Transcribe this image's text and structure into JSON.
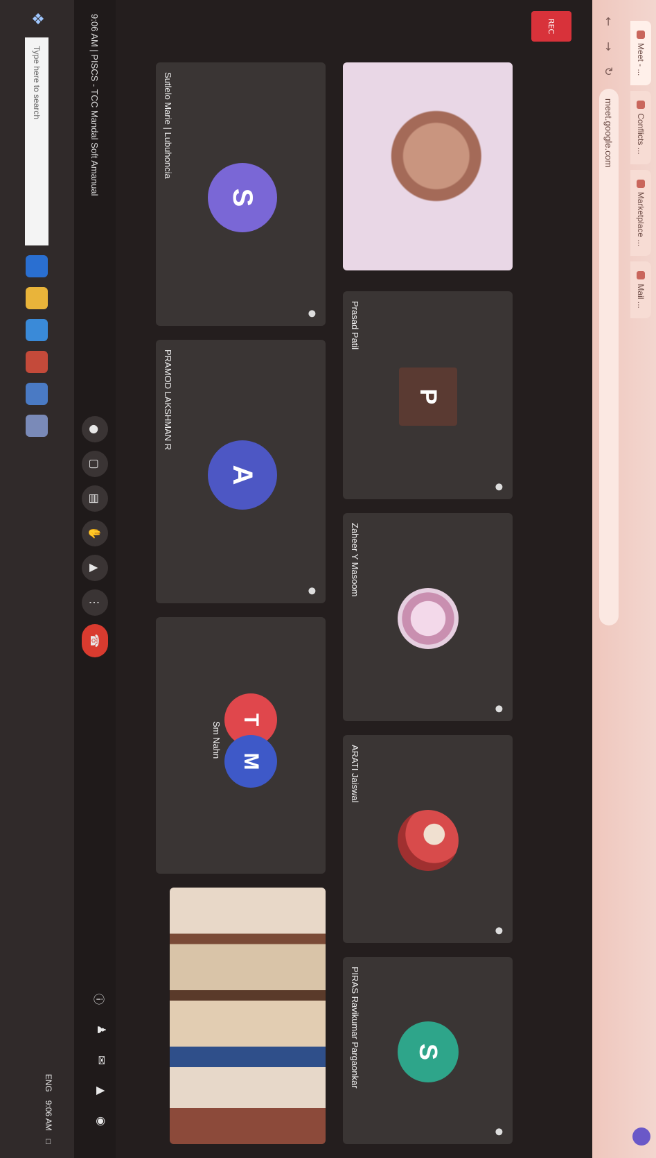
{
  "browser": {
    "tabs": [
      {
        "label": "Meet - ..."
      },
      {
        "label": "Conflicts ..."
      },
      {
        "label": "Marketplace ..."
      },
      {
        "label": "Mail ..."
      }
    ],
    "url": "meet.google.com"
  },
  "meeting": {
    "recording_label": "REC",
    "tiles": [
      {
        "name": "Sutlelo Marie | Lubuhoncia",
        "initial": "S",
        "color": "#7a67d6"
      },
      {
        "name": "PRAMOD LAKSHMAN R",
        "initial": "A",
        "color": "#4d57c4"
      },
      {
        "name": "Sm Nahn",
        "initial": "T",
        "color": "#e0474c",
        "initial2": "M",
        "color2": "#3e59c8"
      },
      {
        "name": "Prasad Patil",
        "initial": "P",
        "color": "#5a3a32"
      },
      {
        "name": "Zaheer Y Masoom",
        "initial": "",
        "color": "#c9b5d8"
      },
      {
        "name": "ARATI Jaiswal",
        "initial": "",
        "color": "#d9a0a0"
      },
      {
        "name": "PIRAS Ravikumar Pargaonkar",
        "initial": "S",
        "color": "#2ea58a"
      }
    ],
    "title": "9:06 AM | PISCS - TCC Mandal Soft Amanual"
  },
  "toolbar": {
    "end_call_icon": "phone-hangup-icon"
  },
  "taskbar": {
    "search_placeholder": "Type here to search",
    "tray_time": "9:06 AM",
    "tray_lang": "ENG"
  }
}
